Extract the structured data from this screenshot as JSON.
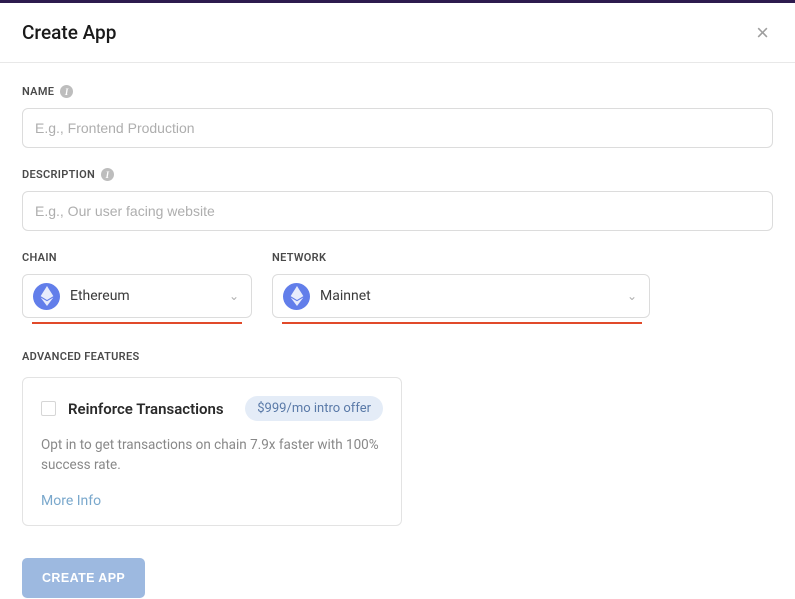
{
  "modal": {
    "title": "Create App"
  },
  "fields": {
    "name": {
      "label": "NAME",
      "placeholder": "E.g., Frontend Production"
    },
    "description": {
      "label": "DESCRIPTION",
      "placeholder": "E.g., Our user facing website"
    },
    "chain": {
      "label": "CHAIN",
      "value": "Ethereum"
    },
    "network": {
      "label": "NETWORK",
      "value": "Mainnet"
    }
  },
  "advanced": {
    "label": "ADVANCED FEATURES",
    "feature": {
      "title": "Reinforce Transactions",
      "price": "$999/mo intro offer",
      "description": "Opt in to get transactions on chain 7.9x faster with 100% success rate.",
      "more_info": "More Info"
    }
  },
  "actions": {
    "create": "CREATE APP"
  }
}
